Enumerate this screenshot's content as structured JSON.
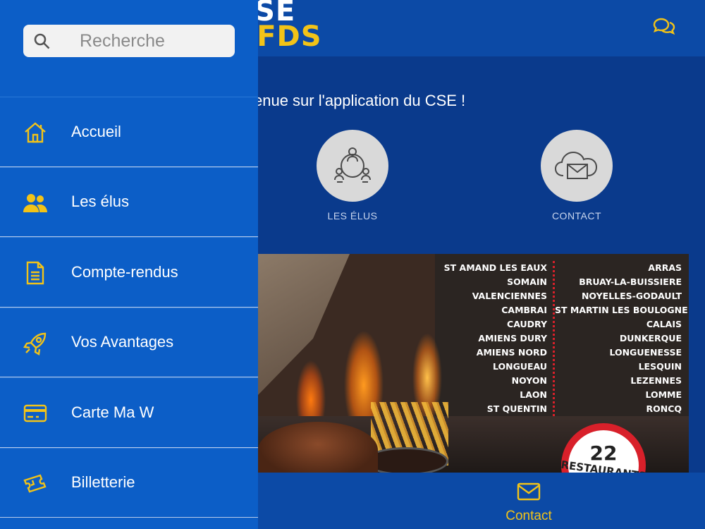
{
  "app": {
    "logo_line1": "CSE",
    "logo_line2": "DFDS"
  },
  "drawer": {
    "search_placeholder": "Recherche",
    "items": [
      {
        "label": "Accueil",
        "icon": "home-icon"
      },
      {
        "label": "Les élus",
        "icon": "users-icon"
      },
      {
        "label": "Compte-rendus",
        "icon": "document-icon"
      },
      {
        "label": "Vos Avantages",
        "icon": "rocket-icon"
      },
      {
        "label": "Carte Ma W",
        "icon": "credit-card-icon"
      },
      {
        "label": "Billetterie",
        "icon": "ticket-icon"
      }
    ]
  },
  "main": {
    "welcome": "enue sur l'application du CSE !",
    "tiles": [
      {
        "label": "LES ÉLUS",
        "icon": "meeting-icon"
      },
      {
        "label": "CONTACT",
        "icon": "cloud-mail-icon"
      }
    ],
    "banner": {
      "cities_left": [
        "ST AMAND LES EAUX",
        "SOMAIN",
        "VALENCIENNES",
        "CAMBRAI",
        "CAUDRY",
        "AMIENS DURY",
        "AMIENS NORD",
        "LONGUEAU",
        "NOYON",
        "LAON",
        "ST QUENTIN"
      ],
      "cities_right": [
        "ARRAS",
        "BRUAY-LA-BUISSIERE",
        "NOYELLES-GODAULT",
        "ST MARTIN LES BOULOGNE",
        "CALAIS",
        "DUNKERQUE",
        "LONGUENESSE",
        "LESQUIN",
        "LEZENNES",
        "LOMME",
        "RONCQ"
      ],
      "badge_number": "22",
      "badge_text": "RESTAURANTS"
    }
  },
  "tabbar": {
    "contact_label": "Contact"
  },
  "colors": {
    "drawer_bg": "#0c5ec7",
    "header_bg": "#0c4aa6",
    "main_bg": "#0a3a8c",
    "accent_yellow": "#f2c318"
  }
}
